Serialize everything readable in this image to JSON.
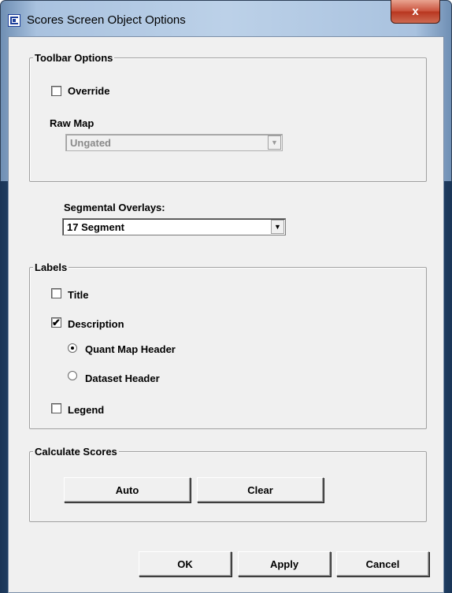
{
  "window": {
    "title": "Scores Screen Object Options",
    "close_label": "x"
  },
  "toolbar_options": {
    "legend": "Toolbar Options",
    "override": {
      "label": "Override",
      "checked": false
    },
    "raw_map": {
      "label": "Raw Map",
      "value": "Ungated",
      "enabled": false
    }
  },
  "segmental_overlays": {
    "label": "Segmental Overlays:",
    "value": "17 Segment"
  },
  "labels": {
    "legend": "Labels",
    "title": {
      "label": "Title",
      "checked": false
    },
    "description": {
      "label": "Description",
      "checked": true
    },
    "quant_map_header": {
      "label": "Quant Map Header",
      "selected": true
    },
    "dataset_header": {
      "label": "Dataset Header",
      "selected": false
    },
    "legend_opt": {
      "label": "Legend",
      "checked": false
    }
  },
  "calculate_scores": {
    "legend": "Calculate Scores",
    "auto_label": "Auto",
    "clear_label": "Clear"
  },
  "footer": {
    "ok_label": "OK",
    "apply_label": "Apply",
    "cancel_label": "Cancel"
  },
  "glyphs": {
    "check": "✔",
    "dropdown_arrow": "▼"
  }
}
